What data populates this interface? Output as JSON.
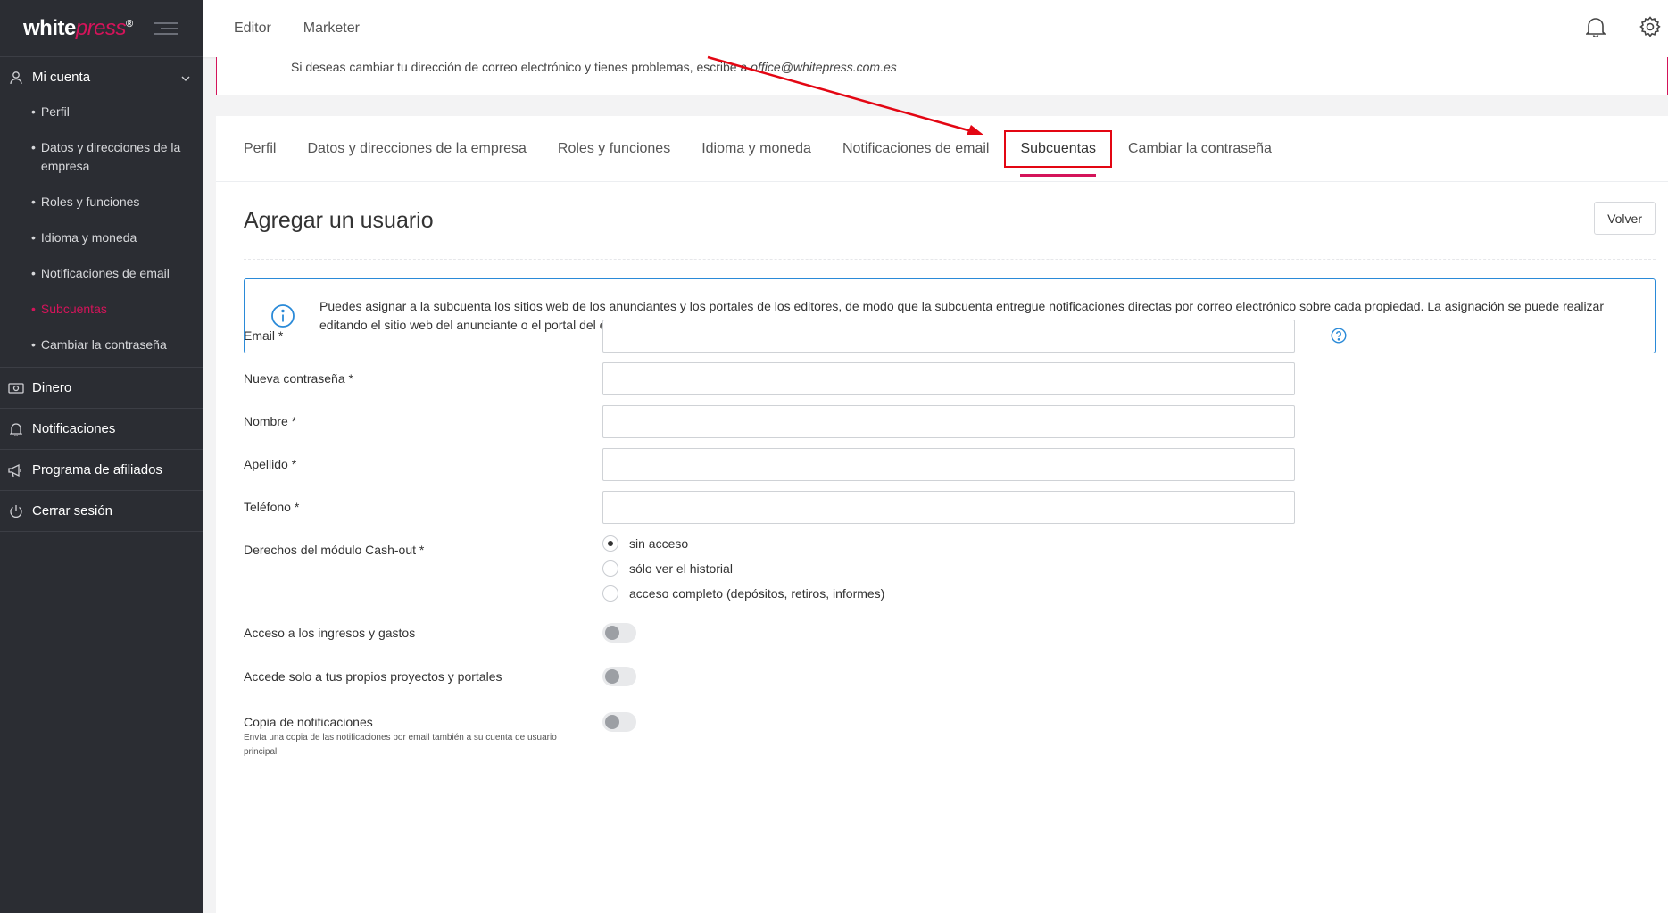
{
  "brand": {
    "logo_white": "white",
    "logo_press": "press",
    "logo_reg": "®"
  },
  "topbar": {
    "mode_editor": "Editor",
    "mode_marketer": "Marketer"
  },
  "sidebar": {
    "account": "Mi cuenta",
    "subitems": [
      {
        "label": "Perfil"
      },
      {
        "label": "Datos y direcciones de la empresa"
      },
      {
        "label": "Roles y funciones"
      },
      {
        "label": "Idioma y moneda"
      },
      {
        "label": "Notificaciones de email"
      },
      {
        "label": "Subcuentas"
      },
      {
        "label": "Cambiar la contraseña"
      }
    ],
    "money": "Dinero",
    "notifications": "Notificaciones",
    "affiliates": "Programa de afiliados",
    "logout": "Cerrar sesión"
  },
  "notice": {
    "text": "Si deseas cambiar tu dirección de correo electrónico y tienes problemas, escribe a ",
    "email": "office@whitepress.com.es"
  },
  "tabs": [
    {
      "label": "Perfil"
    },
    {
      "label": "Datos y direcciones de la empresa"
    },
    {
      "label": "Roles y funciones"
    },
    {
      "label": "Idioma y moneda"
    },
    {
      "label": "Notificaciones de email"
    },
    {
      "label": "Subcuentas"
    },
    {
      "label": "Cambiar la contraseña"
    }
  ],
  "page": {
    "title": "Agregar un usuario",
    "back_button": "Volver",
    "info": "Puedes asignar a la subcuenta los sitios web de los anunciantes y los portales de los editores, de modo que la subcuenta entregue notificaciones directas por correo electrónico sobre cada propiedad. La asignación se puede realizar editando el sitio web del anunciante o el portal del editor."
  },
  "form": {
    "email": "Email *",
    "password": "Nueva contraseña *",
    "name": "Nombre *",
    "surname": "Apellido *",
    "phone": "Teléfono *",
    "cashout": "Derechos del módulo Cash-out *",
    "cashout_options": [
      {
        "label": "sin acceso",
        "checked": true
      },
      {
        "label": "sólo ver el historial",
        "checked": false
      },
      {
        "label": "acceso completo (depósitos, retiros, informes)",
        "checked": false
      }
    ],
    "income_access": "Acceso a los ingresos y gastos",
    "own_projects": "Accede solo a tus propios proyectos y portales",
    "copy_notifications": "Copia de notificaciones",
    "copy_notifications_hint": "Envía una copia de las notificaciones por email también a su cuenta de usuario principal"
  },
  "colors": {
    "accent": "#d4145a",
    "sidebar": "#2b2d33",
    "info": "#2a8ad8",
    "highlight": "#e30613"
  }
}
